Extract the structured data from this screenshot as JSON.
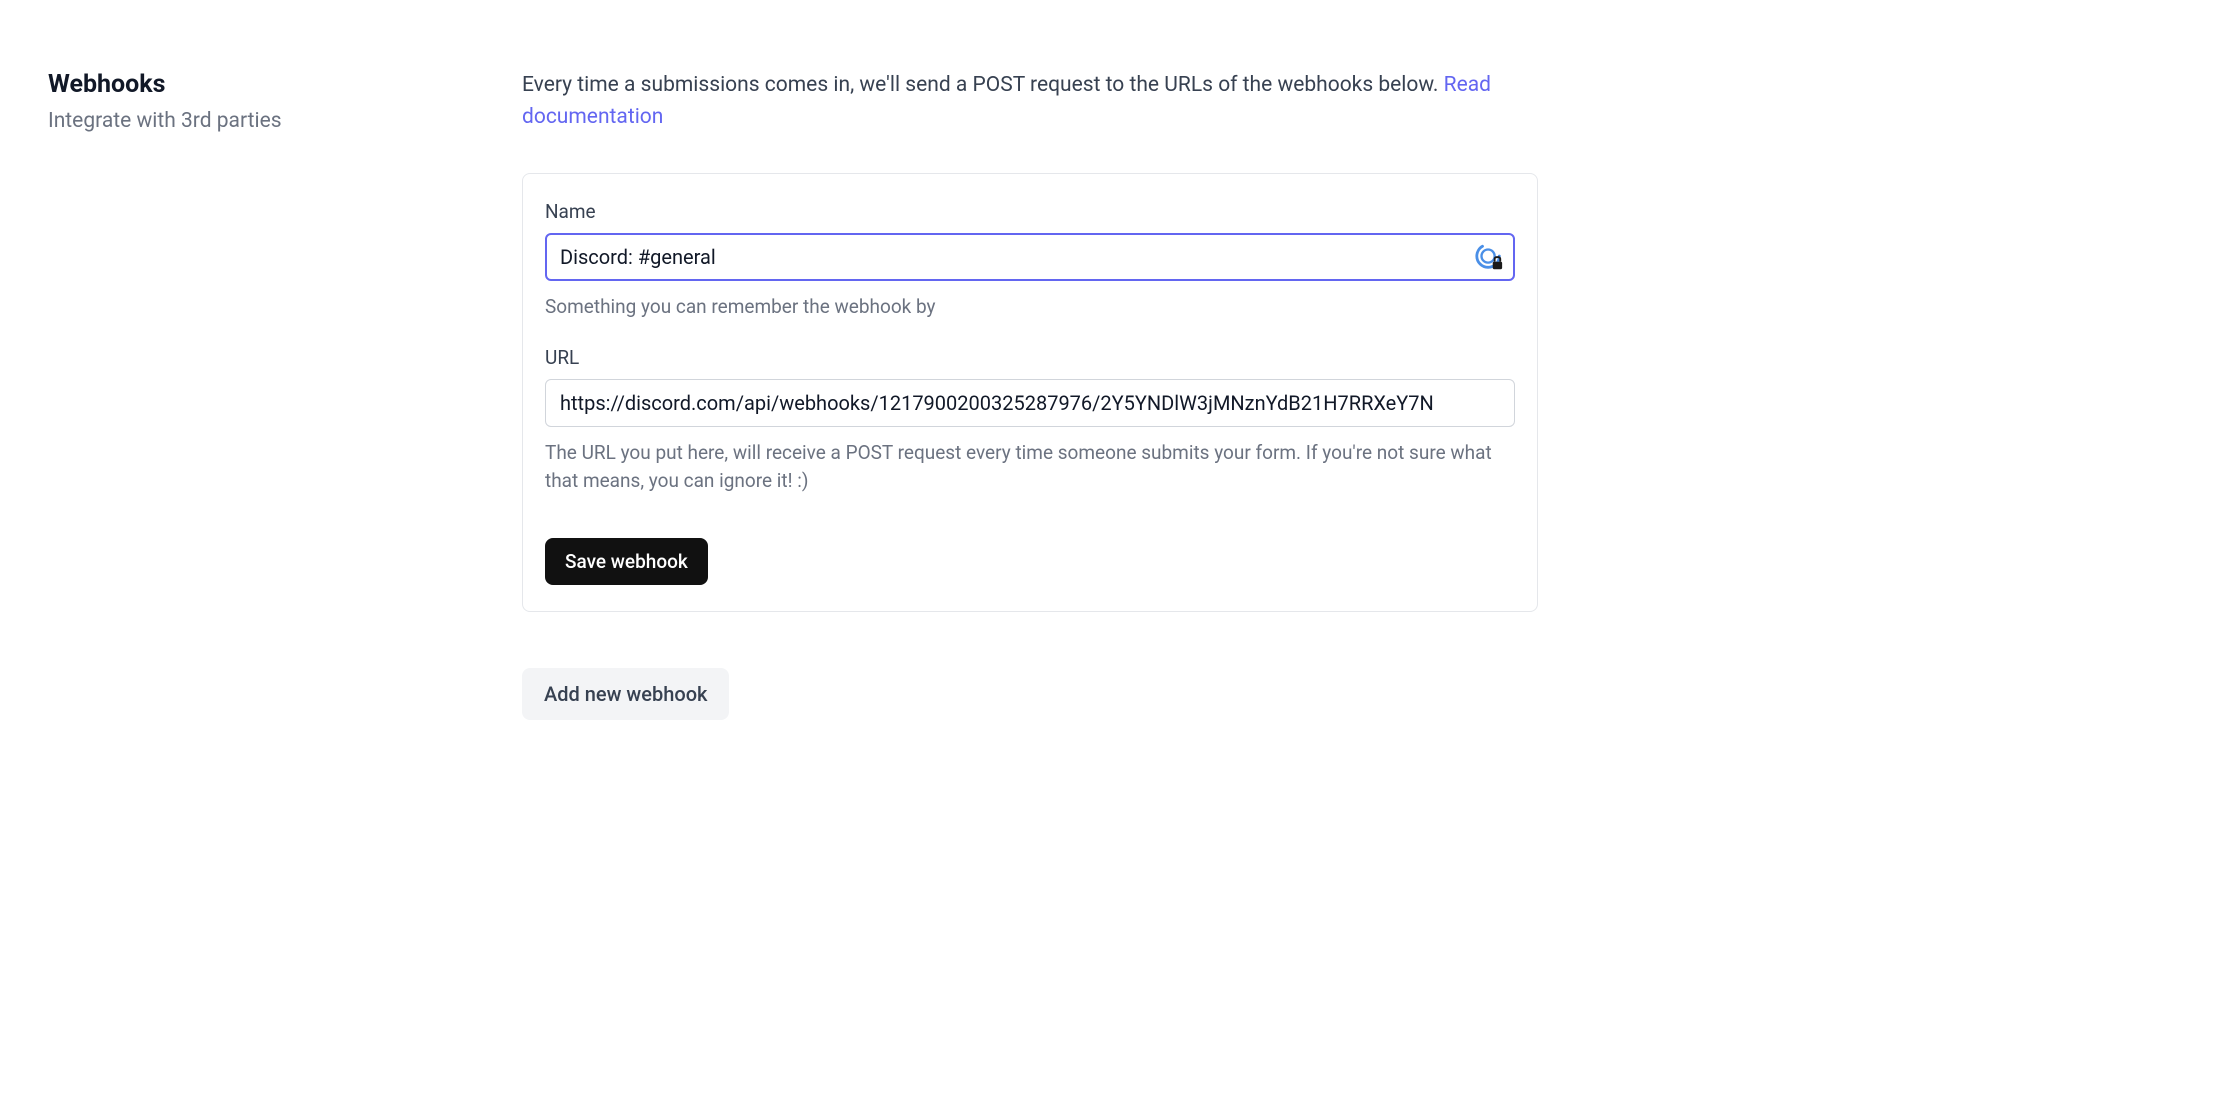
{
  "sidebar": {
    "title": "Webhooks",
    "subtitle": "Integrate with 3rd parties"
  },
  "main": {
    "description_prefix": "Every time a submissions comes in, we'll send a POST request to the URLs of the webhooks below. ",
    "doc_link_text": "Read documentation",
    "webhook": {
      "name_label": "Name",
      "name_value": "Discord: #general",
      "name_hint": "Something you can remember the webhook by",
      "url_label": "URL",
      "url_value": "https://discord.com/api/webhooks/1217900200325287976/2Y5YNDlW3jMNznYdB21H7RRXeY7N",
      "url_hint": "The URL you put here, will receive a POST request every time someone submits your form. If you're not sure what that means, you can ignore it! :)",
      "save_label": "Save webhook"
    },
    "add_button_label": "Add new webhook"
  }
}
